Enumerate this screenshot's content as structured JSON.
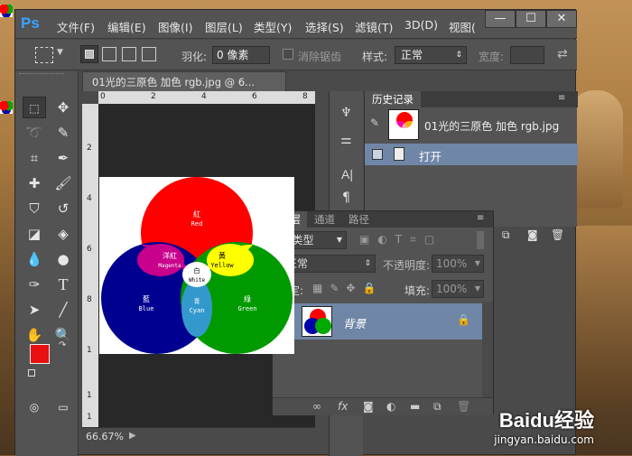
{
  "app": {
    "logo": "Ps",
    "menus": [
      "文件(F)",
      "编辑(E)",
      "图像(I)",
      "图层(L)",
      "类型(Y)",
      "选择(S)",
      "滤镜(T)",
      "3D(D)",
      "视图("
    ],
    "window_buttons": [
      "—",
      "☐",
      "✕"
    ]
  },
  "options": {
    "feather_label": "羽化:",
    "feather_value": "0 像素",
    "antialias_label": "消除锯齿",
    "style_label": "样式:",
    "style_value": "正常",
    "width_label": "宽度:"
  },
  "document": {
    "tab_title": "01光的三原色 加色 rgb.jpg @ 6...",
    "ruler_top": [
      "0",
      "2",
      "4",
      "6",
      "8"
    ],
    "ruler_left": [
      "2",
      "4",
      "6",
      "8",
      "1",
      "1",
      "1"
    ],
    "zoom": "66.67%",
    "image_labels": {
      "red_cn": "紅",
      "red_en": "Red",
      "magenta_cn": "洋紅",
      "magenta_en": "Magenta",
      "yellow_cn": "黃",
      "yellow_en": "Yellow",
      "white_cn": "白",
      "white_en": "White",
      "blue_cn": "藍",
      "blue_en": "Blue",
      "cyan_cn": "青",
      "cyan_en": "Cyan",
      "green_cn": "綠",
      "green_en": "Green"
    }
  },
  "history": {
    "tab": "历史记录",
    "snapshot_name": "01光的三原色 加色 rgb.jpg",
    "step": "打开"
  },
  "layers": {
    "tabs": [
      "图层",
      "通道",
      "路径"
    ],
    "filter_label": "类型",
    "blend_mode": "正常",
    "opacity_label": "不透明度:",
    "opacity_value": "100%",
    "lock_label": "锁定:",
    "fill_label": "填充:",
    "fill_value": "100%",
    "layer_name": "背景"
  },
  "watermark": {
    "brand": "Baidu经验",
    "url": "jingyan.baidu.com"
  },
  "colors": {
    "foreground": "#e81010",
    "background": "#ffffff",
    "selected_row": "#6f86a6",
    "accent": "#3aa3ff"
  }
}
